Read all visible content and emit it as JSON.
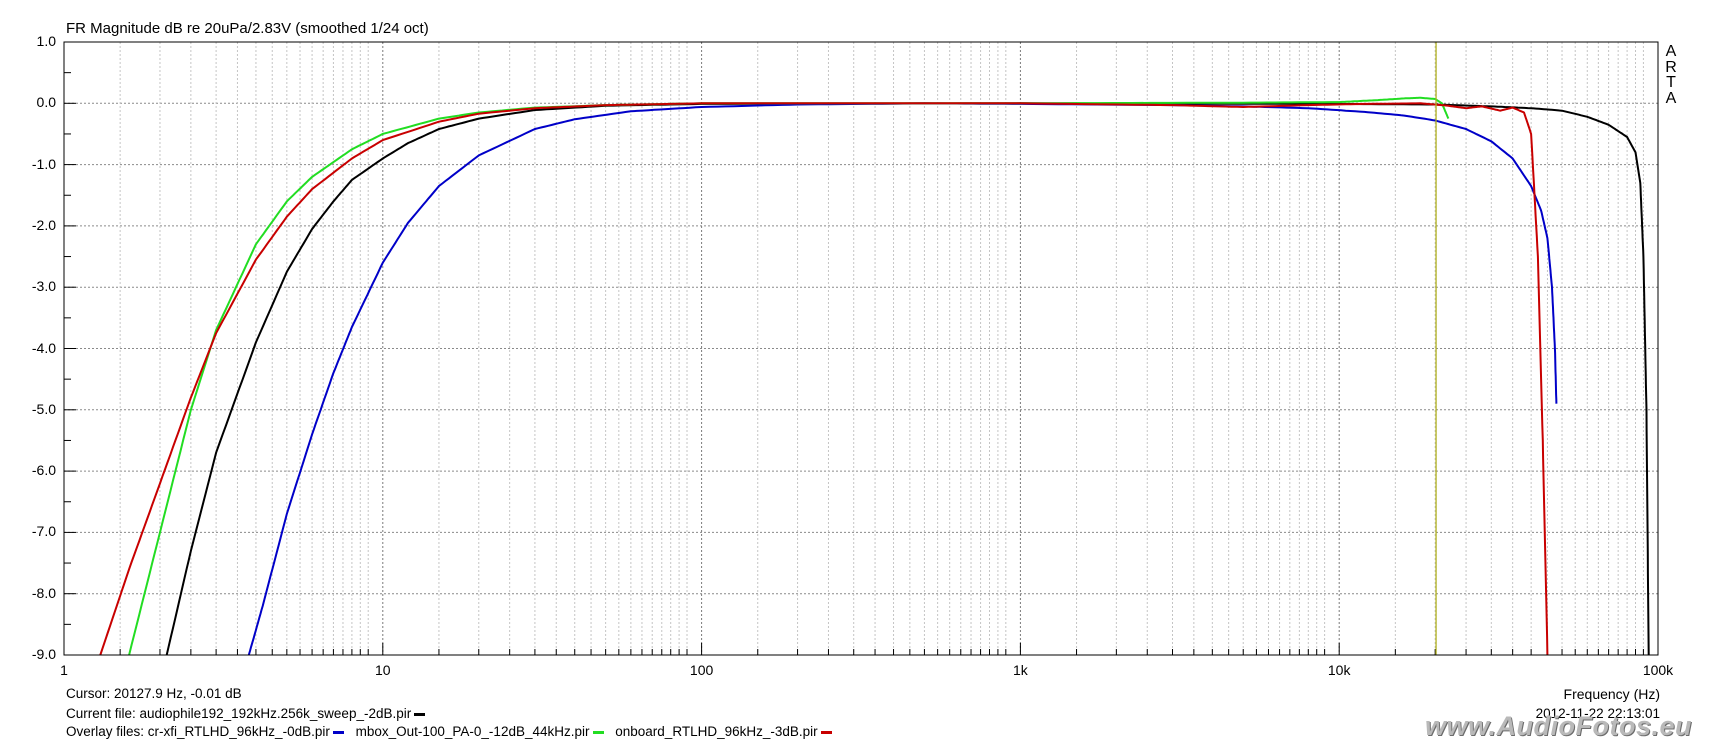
{
  "title": "FR Magnitude dB re 20uPa/2.83V (smoothed 1/24 oct)",
  "side_label": [
    "A",
    "R",
    "T",
    "A"
  ],
  "chart_data": {
    "type": "line",
    "title": "FR Magnitude dB re 20uPa/2.83V (smoothed 1/24 oct)",
    "xlabel": "Frequency (Hz)",
    "ylabel": "",
    "x_scale": "log",
    "xlim": [
      1,
      100000
    ],
    "ylim": [
      -9.0,
      1.0
    ],
    "grid": true,
    "y_ticks": [
      "1.0",
      "0.0",
      "-1.0",
      "-2.0",
      "-3.0",
      "-4.0",
      "-5.0",
      "-6.0",
      "-7.0",
      "-8.0",
      "-9.0"
    ],
    "x_ticks": [
      "1",
      "10",
      "100",
      "1k",
      "10k",
      "100k"
    ],
    "cursor_x": 20127.9,
    "series": [
      {
        "name": "audiophile192_192kHz.256k_sweep_-2dB.pir",
        "color": "#000000",
        "points": [
          [
            2.1,
            -9.0
          ],
          [
            2.5,
            -7.3
          ],
          [
            3,
            -5.7
          ],
          [
            4,
            -3.9
          ],
          [
            5,
            -2.75
          ],
          [
            6,
            -2.05
          ],
          [
            7,
            -1.6
          ],
          [
            8,
            -1.25
          ],
          [
            10,
            -0.9
          ],
          [
            12,
            -0.65
          ],
          [
            15,
            -0.42
          ],
          [
            20,
            -0.25
          ],
          [
            30,
            -0.11
          ],
          [
            50,
            -0.04
          ],
          [
            100,
            -0.01
          ],
          [
            1000,
            0
          ],
          [
            10000,
            -0.01
          ],
          [
            20000,
            -0.02
          ],
          [
            30000,
            -0.05
          ],
          [
            40000,
            -0.08
          ],
          [
            50000,
            -0.12
          ],
          [
            60000,
            -0.22
          ],
          [
            70000,
            -0.35
          ],
          [
            80000,
            -0.55
          ],
          [
            85000,
            -0.8
          ],
          [
            88000,
            -1.3
          ],
          [
            90000,
            -2.5
          ],
          [
            92000,
            -5.0
          ],
          [
            93500,
            -9.0
          ]
        ]
      },
      {
        "name": "cr-xfi_RTLHD_96kHz_-0dB.pir",
        "color": "#0000c8",
        "points": [
          [
            3.8,
            -9.0
          ],
          [
            4.2,
            -8.2
          ],
          [
            5,
            -6.7
          ],
          [
            6,
            -5.4
          ],
          [
            7,
            -4.4
          ],
          [
            8,
            -3.65
          ],
          [
            10,
            -2.6
          ],
          [
            12,
            -1.95
          ],
          [
            15,
            -1.35
          ],
          [
            20,
            -0.85
          ],
          [
            30,
            -0.42
          ],
          [
            40,
            -0.26
          ],
          [
            60,
            -0.13
          ],
          [
            100,
            -0.06
          ],
          [
            200,
            -0.02
          ],
          [
            500,
            0
          ],
          [
            1000,
            -0.01
          ],
          [
            3000,
            -0.03
          ],
          [
            5000,
            -0.05
          ],
          [
            8000,
            -0.08
          ],
          [
            12000,
            -0.14
          ],
          [
            16000,
            -0.2
          ],
          [
            20000,
            -0.28
          ],
          [
            25000,
            -0.42
          ],
          [
            30000,
            -0.62
          ],
          [
            35000,
            -0.9
          ],
          [
            40000,
            -1.35
          ],
          [
            43000,
            -1.75
          ],
          [
            45000,
            -2.2
          ],
          [
            46500,
            -3.0
          ],
          [
            47500,
            -4.0
          ],
          [
            48000,
            -4.9
          ]
        ]
      },
      {
        "name": "mbox_Out-100_PA-0_-12dB_44kHz.pir",
        "color": "#22dd22",
        "points": [
          [
            1.6,
            -9.0
          ],
          [
            2,
            -7.0
          ],
          [
            2.5,
            -5.0
          ],
          [
            3,
            -3.7
          ],
          [
            4,
            -2.3
          ],
          [
            5,
            -1.6
          ],
          [
            6,
            -1.2
          ],
          [
            8,
            -0.75
          ],
          [
            10,
            -0.5
          ],
          [
            15,
            -0.25
          ],
          [
            20,
            -0.15
          ],
          [
            30,
            -0.07
          ],
          [
            50,
            -0.03
          ],
          [
            100,
            0
          ],
          [
            1000,
            0
          ],
          [
            5000,
            0.01
          ],
          [
            10000,
            0.02
          ],
          [
            13000,
            0.05
          ],
          [
            16000,
            0.08
          ],
          [
            18000,
            0.09
          ],
          [
            20000,
            0.07
          ],
          [
            21000,
            0.0
          ],
          [
            22000,
            -0.25
          ]
        ]
      },
      {
        "name": "onboard_RTLHD_96kHz_-3dB.pir",
        "color": "#c80000",
        "points": [
          [
            1.3,
            -9.0
          ],
          [
            1.6,
            -7.6
          ],
          [
            2,
            -6.2
          ],
          [
            2.5,
            -4.8
          ],
          [
            3,
            -3.75
          ],
          [
            4,
            -2.55
          ],
          [
            5,
            -1.85
          ],
          [
            6,
            -1.4
          ],
          [
            8,
            -0.9
          ],
          [
            10,
            -0.6
          ],
          [
            15,
            -0.3
          ],
          [
            20,
            -0.17
          ],
          [
            30,
            -0.08
          ],
          [
            50,
            -0.03
          ],
          [
            100,
            0
          ],
          [
            1000,
            0
          ],
          [
            3000,
            -0.03
          ],
          [
            5000,
            -0.06
          ],
          [
            8000,
            -0.03
          ],
          [
            12000,
            -0.01
          ],
          [
            18000,
            0.0
          ],
          [
            22000,
            -0.04
          ],
          [
            25000,
            -0.08
          ],
          [
            28000,
            -0.05
          ],
          [
            32000,
            -0.12
          ],
          [
            35000,
            -0.07
          ],
          [
            38000,
            -0.15
          ],
          [
            40000,
            -0.5
          ],
          [
            42000,
            -2.5
          ],
          [
            43500,
            -5.5
          ],
          [
            45000,
            -9.0
          ]
        ]
      }
    ]
  },
  "footer": {
    "cursor": "Cursor: 20127.9 Hz, -0.01 dB",
    "current_label": "Current file: ",
    "current_file": "audiophile192_192kHz.256k_sweep_-2dB.pir",
    "overlay_label": "Overlay files: ",
    "overlay_1": "cr-xfi_RTLHD_96kHz_-0dB.pir",
    "overlay_2": "mbox_Out-100_PA-0_-12dB_44kHz.pir",
    "overlay_3": "onboard_RTLHD_96kHz_-3dB.pir",
    "frequency_label": "Frequency (Hz)",
    "datetime": "2012-11-22  22:13:01"
  },
  "watermark": "www.AudioFotos.eu",
  "colors": {
    "current": "#000000",
    "overlay_1": "#0000c8",
    "overlay_2": "#22dd22",
    "overlay_3": "#c80000",
    "cursor": "#b0b020"
  }
}
